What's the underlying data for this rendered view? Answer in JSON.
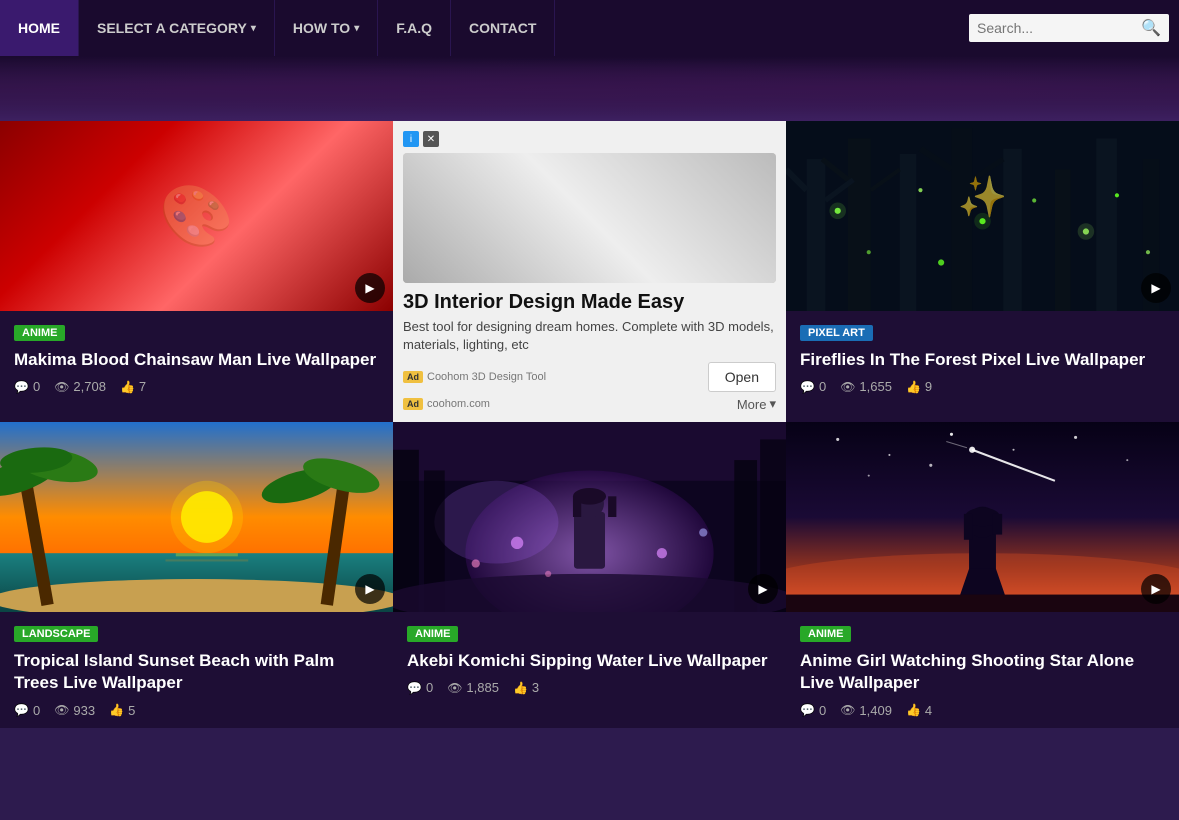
{
  "nav": {
    "items": [
      {
        "label": "HOME",
        "active": true
      },
      {
        "label": "SELECT A CATEGORY",
        "hasDropdown": true,
        "active": false
      },
      {
        "label": "HOW TO",
        "hasDropdown": true,
        "active": false
      },
      {
        "label": "F.A.Q",
        "active": false
      },
      {
        "label": "CONTACT",
        "active": false
      }
    ],
    "search_placeholder": "Search..."
  },
  "cards": [
    {
      "id": "makima",
      "thumb_type": "makima",
      "category": "ANIME",
      "category_class": "badge-anime",
      "title": "Makima Blood Chainsaw Man Live Wallpaper",
      "comments": "0",
      "views": "2,708",
      "likes": "7"
    },
    {
      "id": "fireflies",
      "thumb_type": "fireflies",
      "category": "PIXEL ART",
      "category_class": "badge-pixel-art",
      "title": "Fireflies In The Forest Pixel Live Wallpaper",
      "comments": "0",
      "views": "1,655",
      "likes": "9"
    },
    {
      "id": "tropical",
      "thumb_type": "tropical",
      "category": "LANDSCAPE",
      "category_class": "badge-landscape",
      "title": "Tropical Island Sunset Beach with Palm Trees Live Wallpaper",
      "comments": "0",
      "views": "933",
      "likes": "5"
    },
    {
      "id": "akebi",
      "thumb_type": "akebi",
      "category": "ANIME",
      "category_class": "badge-anime",
      "title": "Akebi Komichi Sipping Water Live Wallpaper",
      "comments": "0",
      "views": "1,885",
      "likes": "3"
    },
    {
      "id": "anime-girl",
      "thumb_type": "anime-girl",
      "category": "ANIME",
      "category_class": "badge-anime",
      "title": "Anime Girl Watching Shooting Star Alone Live Wallpaper",
      "comments": "0",
      "views": "1,409",
      "likes": "4"
    }
  ],
  "ad": {
    "title": "3D Interior Design Made Easy",
    "description": "Best tool for designing dream homes. Complete with 3D models, materials, lighting, etc",
    "brand": "Coohom 3D Design Tool",
    "domain": "coohom.com",
    "open_label": "Open",
    "more_label": "More"
  },
  "icons": {
    "comment": "💬",
    "eye": "👁",
    "thumbup": "👍",
    "play": "▶",
    "search": "🔍",
    "chevron": "▾",
    "x": "✕",
    "info": "i",
    "triangle": "▾"
  }
}
